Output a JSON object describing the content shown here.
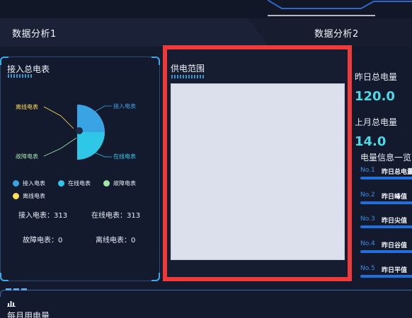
{
  "header": {
    "tabs": [
      {
        "label": "数据分析1"
      },
      {
        "label": "数据分析2"
      }
    ]
  },
  "left_panel": {
    "title": "接入总电表",
    "pie": {
      "labels": {
        "offline": "离线电表",
        "access": "接入电表",
        "fault": "故障电表",
        "online": "在线电表"
      }
    },
    "legend": [
      {
        "label": "接入电表",
        "color": "#3aa3e3"
      },
      {
        "label": "在线电表",
        "color": "#2fc7e8"
      },
      {
        "label": "故障电表",
        "color": "#9fe6a8"
      },
      {
        "label": "离线电表",
        "color": "#ffdd55"
      }
    ],
    "stats": {
      "access": "接入电表：313",
      "online": "在线电表：313",
      "fault": "故障电表：0",
      "offline": "离线电表：0"
    }
  },
  "center_panel": {
    "title": "供电范围"
  },
  "right_panel": {
    "yesterday_label": "昨日总电量",
    "yesterday_value": "120.0",
    "last_month_label": "上月总电量",
    "last_month_value": "14.0",
    "list_title": "电量信息一览",
    "list": [
      {
        "num": "No.1",
        "name": "昨日总电量"
      },
      {
        "num": "No.2",
        "name": "昨日峰值"
      },
      {
        "num": "No.3",
        "name": "昨日尖值"
      },
      {
        "num": "No.4",
        "name": "昨日谷值"
      },
      {
        "num": "No.5",
        "name": "昨日平值"
      }
    ]
  },
  "bottom_panel": {
    "title": "每月用电量"
  },
  "colors": {
    "accent": "#4fd8e6",
    "highlight_border": "#f03a3a",
    "bar_blue": "#1f6fdc"
  }
}
